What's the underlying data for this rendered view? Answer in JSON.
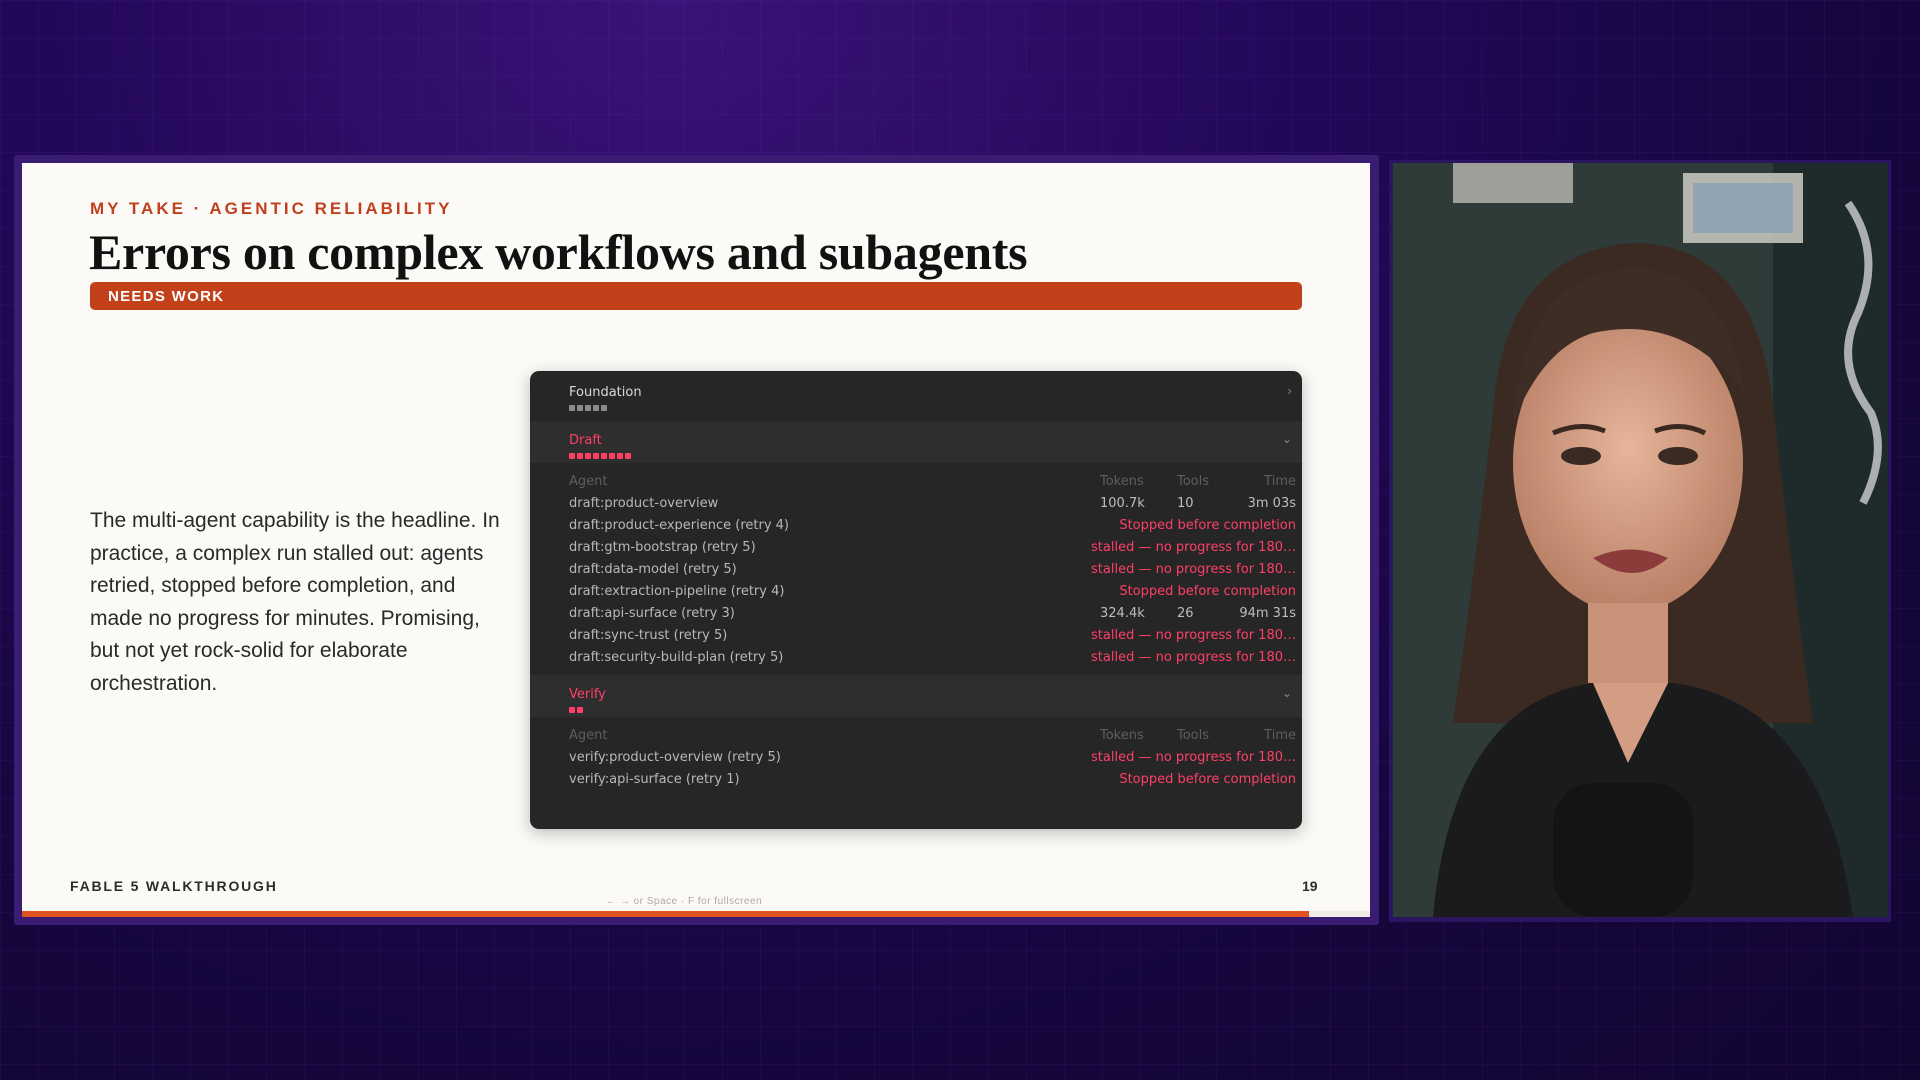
{
  "slide": {
    "eyebrow": "MY TAKE · AGENTIC RELIABILITY",
    "title": "Errors on complex workflows and subagents",
    "status_label": "NEEDS WORK",
    "body": "The multi-agent capability is the headline. In practice, a complex run stalled out: agents retried, stopped before completion, and made no progress for minutes. Promising, but not yet rock-solid for elaborate orchestration.",
    "footer_left": "FABLE 5 WALKTHROUGH",
    "footer_hint": "← → or Space · F for fullscreen",
    "page_number": "19",
    "progress_fraction": 0.955
  },
  "panel": {
    "columns": {
      "agent": "Agent",
      "tokens": "Tokens",
      "tools": "Tools",
      "time": "Time"
    },
    "groups": [
      {
        "name": "Foundation",
        "state": "collapsed",
        "chevron": "›",
        "name_color": "#d9d9d9",
        "dot_count": 5,
        "dot_color": "#8a8a8a"
      },
      {
        "name": "Draft",
        "state": "expanded",
        "chevron": "⌄",
        "name_color": "#ff3f67",
        "dot_count": 8,
        "dot_color": "#ff3f67",
        "rows": [
          {
            "agent": "draft:product-overview",
            "tokens": "100.7k",
            "tools": "10",
            "time": "3m 03s"
          },
          {
            "agent": "draft:product-experience (retry 4)",
            "status": "Stopped before completion"
          },
          {
            "agent": "draft:gtm-bootstrap (retry 5)",
            "status": "stalled — no progress for 180…"
          },
          {
            "agent": "draft:data-model (retry 5)",
            "status": "stalled — no progress for 180…"
          },
          {
            "agent": "draft:extraction-pipeline (retry 4)",
            "status": "Stopped before completion"
          },
          {
            "agent": "draft:api-surface (retry 3)",
            "tokens": "324.4k",
            "tools": "26",
            "time": "94m 31s"
          },
          {
            "agent": "draft:sync-trust (retry 5)",
            "status": "stalled — no progress for 180…"
          },
          {
            "agent": "draft:security-build-plan (retry 5)",
            "status": "stalled — no progress for 180…"
          }
        ]
      },
      {
        "name": "Verify",
        "state": "expanded",
        "chevron": "⌄",
        "name_color": "#ff3f67",
        "dot_count": 2,
        "dot_color": "#ff3f67",
        "rows": [
          {
            "agent": "verify:product-overview (retry 5)",
            "status": "stalled — no progress for 180…"
          },
          {
            "agent": "verify:api-surface (retry 1)",
            "status": "Stopped before completion"
          }
        ]
      }
    ]
  },
  "colors": {
    "accent": "#c2401a",
    "error": "#ff3f67",
    "panel_bg": "#262626",
    "background": "#1a0846"
  },
  "webcam": {
    "label": "presenter-video-feed"
  }
}
